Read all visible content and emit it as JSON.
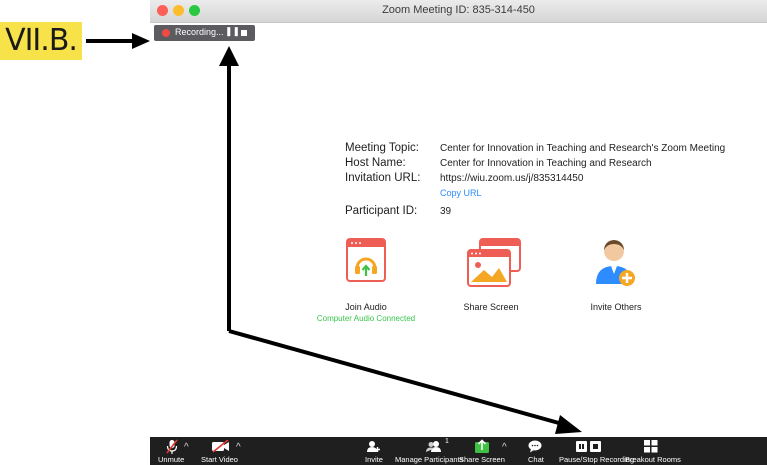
{
  "annotation": {
    "label": "VII.B."
  },
  "window": {
    "title": "Zoom Meeting ID: 835-314-450",
    "recording_bar": {
      "status": "Recording..."
    }
  },
  "meeting_info": {
    "topic_label": "Meeting Topic:",
    "topic_value": "Center for Innovation in Teaching and Research's Zoom Meeting",
    "host_label": "Host Name:",
    "host_value": "Center for Innovation in Teaching and Research",
    "url_label": "Invitation URL:",
    "url_value": "https://wiu.zoom.us/j/835314450",
    "copy_url": "Copy URL",
    "participant_label": "Participant ID:",
    "participant_value": "39"
  },
  "actions": {
    "join_audio": "Join Audio",
    "join_audio_status": "Computer Audio Connected",
    "share_screen": "Share Screen",
    "invite_others": "Invite Others"
  },
  "toolbar": {
    "unmute": "Unmute",
    "start_video": "Start Video",
    "invite": "Invite",
    "manage_participants": "Manage Participants",
    "participant_count": "1",
    "share_screen": "Share Screen",
    "chat": "Chat",
    "pause_stop_recording": "Pause/Stop Recording",
    "breakout_rooms": "Breakout Rooms"
  },
  "colors": {
    "accent": "#2d8cff",
    "audio_connected": "#39c54e",
    "share_green": "#3fc143",
    "toolbar_bg": "#1f1f1f",
    "annotation_highlight": "#f7e24a",
    "icon_red": "#ef5e55"
  }
}
